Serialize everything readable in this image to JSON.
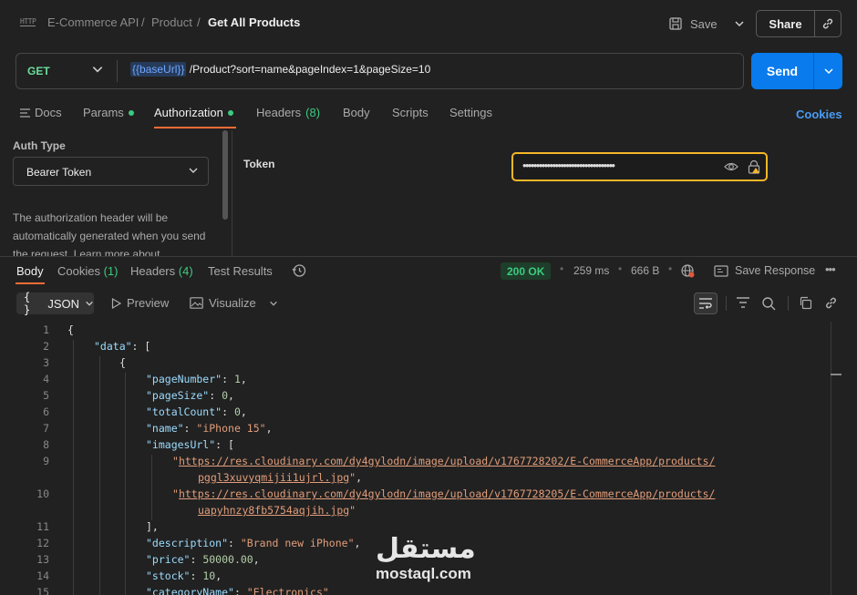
{
  "header": {
    "http_icon_text": "HTTP",
    "breadcrumb": [
      "E-Commerce API",
      "Product",
      "Get All Products"
    ],
    "save_label": "Save",
    "share_label": "Share"
  },
  "request": {
    "method": "GET",
    "url_variable": "{{baseUrl}}",
    "url_path": "/Product?sort=name&pageIndex=1&pageSize=10",
    "send_label": "Send"
  },
  "tabs": {
    "docs": "Docs",
    "params": "Params",
    "authorization": "Authorization",
    "headers": "Headers",
    "headers_count": "(8)",
    "body": "Body",
    "scripts": "Scripts",
    "settings": "Settings",
    "cookies_link": "Cookies"
  },
  "auth": {
    "type_label": "Auth Type",
    "type_value": "Bearer Token",
    "description": "The authorization header will be automatically generated when you send the request. Learn more about",
    "token_label": "Token",
    "token_masked": "••••••••••••••••••••••••••••••••••"
  },
  "response": {
    "tabs": {
      "body": "Body",
      "cookies": "Cookies",
      "cookies_count": "(1)",
      "headers": "Headers",
      "headers_count": "(4)",
      "test_results": "Test Results"
    },
    "status": "200 OK",
    "time": "259 ms",
    "size": "666 B",
    "save_response_label": "Save Response",
    "format": "JSON",
    "preview_label": "Preview",
    "visualize_label": "Visualize"
  },
  "code_lines": [
    {
      "n": "1"
    },
    {
      "n": "2"
    },
    {
      "n": "3"
    },
    {
      "n": "4"
    },
    {
      "n": "5"
    },
    {
      "n": "6"
    },
    {
      "n": "7"
    },
    {
      "n": "8"
    },
    {
      "n": "9"
    },
    {
      "n": "10"
    },
    {
      "n": "11"
    },
    {
      "n": "12"
    },
    {
      "n": "13"
    },
    {
      "n": "14"
    },
    {
      "n": "15"
    }
  ],
  "code": {
    "l1": "{",
    "l2_key": "\"data\"",
    "l2_rest": ": [",
    "l3": "{",
    "l4_key": "\"pageNumber\"",
    "l4_val": "1",
    "l5_key": "\"pageSize\"",
    "l5_val": "0",
    "l6_key": "\"totalCount\"",
    "l6_val": "0",
    "l7_key": "\"name\"",
    "l7_val": "\"iPhone 15\"",
    "l8_key": "\"imagesUrl\"",
    "l8_rest": ": [",
    "l9_url_a": "https://res.cloudinary.com/dy4gylodn/image/upload/v1767728202/E-CommerceApp/products/",
    "l9_url_b": "pggl3xuvyqmijii1ujrl.jpg",
    "l10_url_a": "https://res.cloudinary.com/dy4gylodn/image/upload/v1767728205/E-CommerceApp/products/",
    "l10_url_b": "uapyhnzy8fb5754aqjih.jpg",
    "l11": "],",
    "l12_key": "\"description\"",
    "l12_val": "\"Brand new iPhone\"",
    "l13_key": "\"price\"",
    "l13_val": "50000.00",
    "l14_key": "\"stock\"",
    "l14_val": "10",
    "l15_key": "\"categoryName\"",
    "l15_val": "\"Electronics\""
  },
  "watermark": {
    "arabic": "مستقل",
    "latin": "mostaql.com"
  },
  "colors": {
    "accent_orange": "#ff6c37",
    "send_blue": "#097bed",
    "status_green": "#3ccb7f",
    "token_border": "#f5b629"
  }
}
